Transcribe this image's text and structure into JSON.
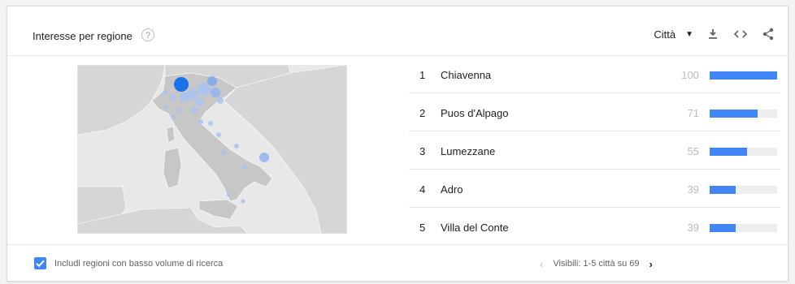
{
  "header": {
    "title": "Interesse per regione",
    "help_icon": "question-mark-icon",
    "resolution_label": "Città",
    "icons": [
      "download-icon",
      "embed-code-icon",
      "share-icon"
    ]
  },
  "map": {
    "bubble_color": "#1a73e8",
    "bubble_light_color": "#a7c2f2"
  },
  "regions": [
    {
      "rank": "1",
      "name": "Chiavenna",
      "score": "100",
      "value": 100
    },
    {
      "rank": "2",
      "name": "Puos d'Alpago",
      "score": "71",
      "value": 71
    },
    {
      "rank": "3",
      "name": "Lumezzane",
      "score": "55",
      "value": 55
    },
    {
      "rank": "4",
      "name": "Adro",
      "score": "39",
      "value": 39
    },
    {
      "rank": "5",
      "name": "Villa del Conte",
      "score": "39",
      "value": 39
    }
  ],
  "colors": {
    "accent": "#4285f4",
    "bar_track": "#eeeeee"
  },
  "footer": {
    "checkbox_label": "Includi regioni con basso volume di ricerca",
    "checkbox_checked": true,
    "pagination_text": "Visibili: 1-5 città su 69"
  }
}
